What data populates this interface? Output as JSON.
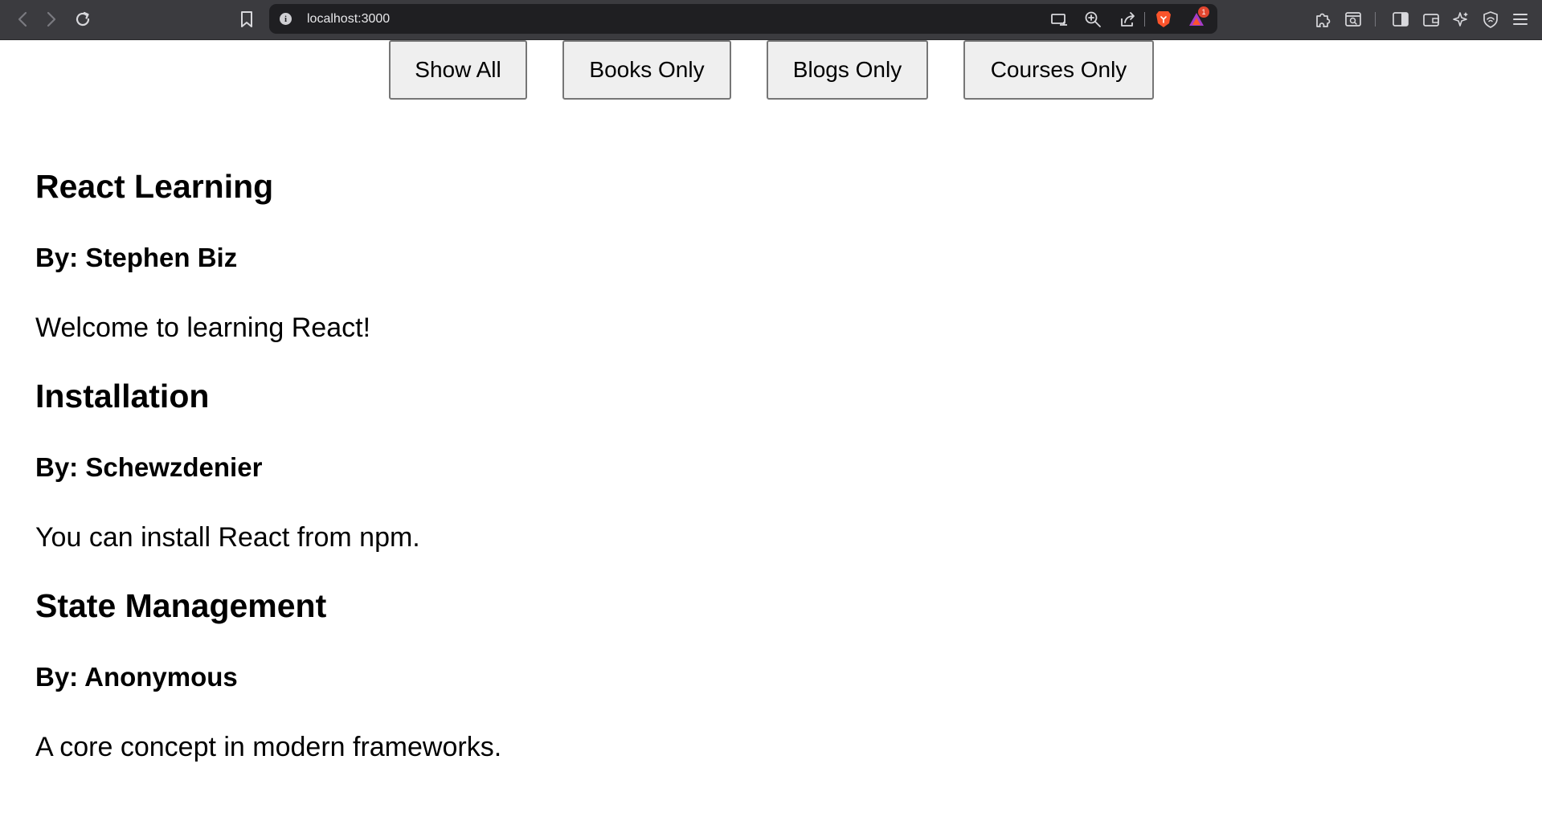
{
  "browser": {
    "url": "localhost:3000",
    "notification_count": "1",
    "theme": {
      "chrome_bg": "#3b3b3f",
      "urlbar_bg": "#1f1f22",
      "brave_orange": "#fb542b",
      "badge_red": "#e2462f"
    },
    "icons": [
      "back-icon",
      "forward-icon",
      "reload-icon",
      "bookmark-icon",
      "site-info-icon",
      "cast-icon",
      "zoom-icon",
      "share-icon",
      "brave-shields-icon",
      "brave-rewards-icon",
      "extensions-icon",
      "tab-search-icon",
      "sidebar-icon",
      "wallet-icon",
      "leo-ai-icon",
      "vpn-icon",
      "menu-icon"
    ]
  },
  "filters": {
    "show_all": "Show All",
    "books_only": "Books Only",
    "blogs_only": "Blogs Only",
    "courses_only": "Courses Only"
  },
  "posts": [
    {
      "title": "React Learning",
      "author": "By: Stephen Biz",
      "body": "Welcome to learning React!"
    },
    {
      "title": "Installation",
      "author": "By: Schewzdenier",
      "body": "You can install React from npm."
    },
    {
      "title": "State Management",
      "author": "By: Anonymous",
      "body": "A core concept in modern frameworks."
    }
  ]
}
